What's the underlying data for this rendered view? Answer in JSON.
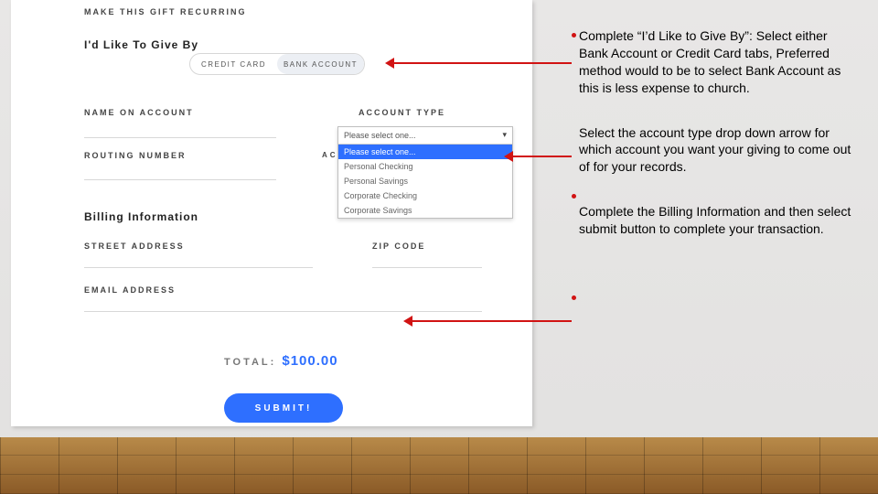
{
  "form": {
    "recurring_label": "MAKE THIS GIFT RECURRING",
    "give_by_hdr": "I'd Like To Give By",
    "pill_credit": "CREDIT CARD",
    "pill_bank": "BANK ACCOUNT",
    "name_label": "NAME ON ACCOUNT",
    "type_label": "ACCOUNT TYPE",
    "routing_label": "ROUTING NUMBER",
    "acctnum_label": "ACCOUNT NUMBER",
    "billing_hdr": "Billing Information",
    "street_label": "STREET ADDRESS",
    "zip_label": "ZIP CODE",
    "email_label": "EMAIL ADDRESS",
    "dropdown": {
      "head": "Please select one...",
      "sel": "Please select one...",
      "opt1": "Personal Checking",
      "opt2": "Personal Savings",
      "opt3": "Corporate Checking",
      "opt4": "Corporate Savings"
    },
    "total_label": "TOTAL:",
    "total_amount": "$100.00",
    "submit_label": "SUBMIT!"
  },
  "notes": {
    "p1": "Complete “I’d Like to Give By”: Select either Bank Account or Credit Card tabs, Preferred method would to be to select Bank Account as this is less expense to church.",
    "p2": "Select the account type drop down arrow for which account you want your giving to come out of for your records.",
    "p3": "Complete the Billing Information and then select submit button to complete your transaction."
  }
}
